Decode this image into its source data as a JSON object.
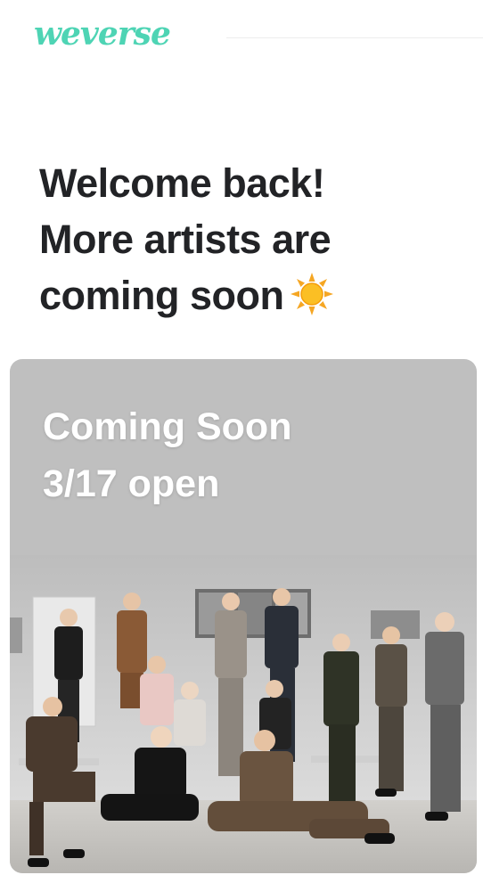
{
  "header": {
    "logo_text": "weverse",
    "logo_color": "#4ed4b4"
  },
  "headline": {
    "line1": "Welcome back!",
    "line2": "More artists are",
    "line3": "coming soon",
    "emoji_icon": "sun-icon"
  },
  "banner": {
    "title": "Coming Soon",
    "subtitle": "3/17 open",
    "image": "group-photo",
    "background": "#bfbfbf"
  }
}
